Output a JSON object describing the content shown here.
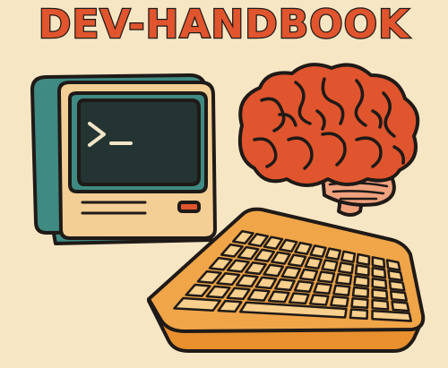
{
  "title": "DEV-HANDBOOK",
  "colors": {
    "background": "#f7e6c4",
    "title_fill": "#e0552e",
    "outline": "#1f1a17",
    "monitor_teal": "#3f8a82",
    "monitor_cream": "#f3cf96",
    "screen": "#233432",
    "prompt": "#f3e6c8",
    "brain": "#e0552e",
    "brain_stem": "#f0a27e",
    "keyboard_body": "#f0a548",
    "keyboard_keys": "#f8cf8c",
    "button_red": "#e0552e"
  },
  "icons": {
    "computer": "retro-computer-icon",
    "brain": "brain-icon",
    "keyboard": "keyboard-icon"
  }
}
